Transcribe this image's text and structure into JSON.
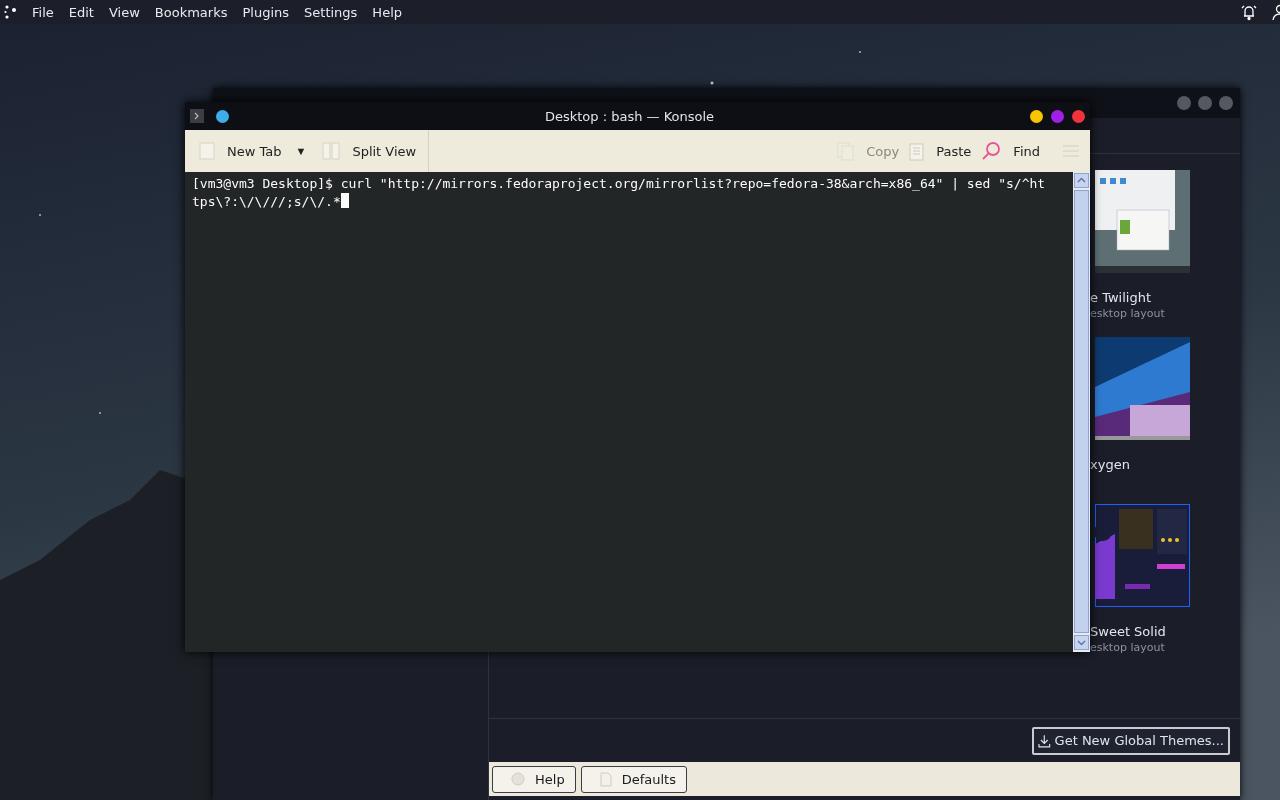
{
  "menu_bar": {
    "items": [
      "File",
      "Edit",
      "View",
      "Bookmarks",
      "Plugins",
      "Settings",
      "Help"
    ]
  },
  "settings_window": {
    "themes": [
      {
        "name": "e Twilight",
        "subtitle": "esktop layout",
        "kind": "picture"
      },
      {
        "name": "xygen",
        "kind": "picture"
      },
      {
        "name": "Sweet Solid",
        "subtitle": "esktop layout",
        "kind": "picture"
      }
    ],
    "get_new_button": "Get New Global Themes...",
    "footer_buttons": [
      {
        "label": "Help",
        "kind": "help"
      },
      {
        "label": "Defaults",
        "kind": "defaults"
      }
    ]
  },
  "konsole": {
    "title": "Desktop : bash — Konsole",
    "toolbar_left": [
      {
        "label": "New Tab",
        "kind": "new-tab",
        "disabled": false,
        "dropdown": "▼"
      },
      {
        "label": "Split View",
        "kind": "split-view",
        "disabled": false
      }
    ],
    "toolbar_right": [
      {
        "label": "Copy",
        "kind": "copy",
        "disabled": true
      },
      {
        "label": "Paste",
        "kind": "paste",
        "disabled": false
      },
      {
        "label": "Find",
        "kind": "find",
        "disabled": false
      }
    ],
    "terminal_text": "[vm3@vm3 Desktop]$ curl \"http://mirrors.fedoraproject.org/mirrorlist?repo=fedora-38&arch=x86_64\" | sed \"s/^https\\?:\\/\\///;s/\\/.*"
  }
}
